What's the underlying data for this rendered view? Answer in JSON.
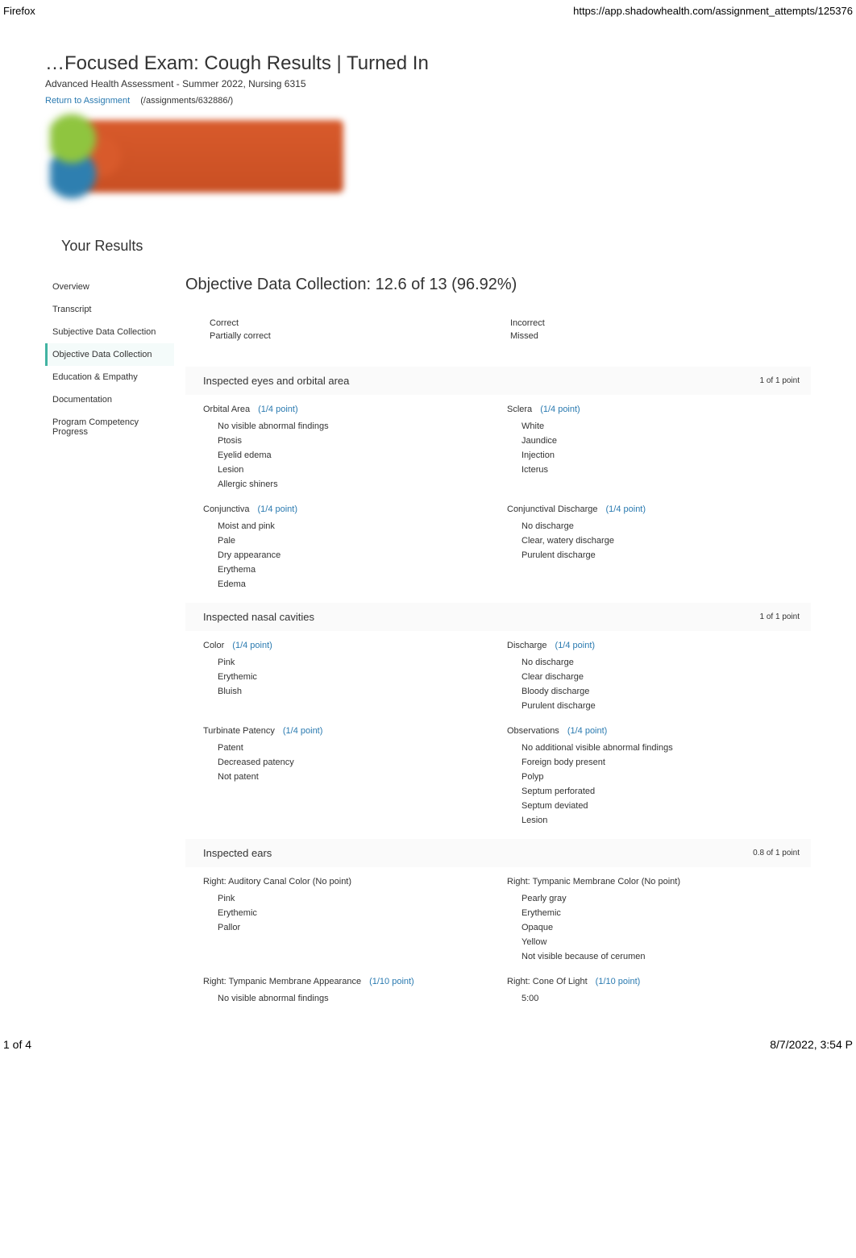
{
  "browser": {
    "name": "Firefox",
    "url": "https://app.shadowhealth.com/assignment_attempts/125376"
  },
  "header": {
    "title": "…Focused Exam: Cough Results | Turned In",
    "subtitle": "Advanced Health Assessment - Summer 2022, Nursing 6315",
    "return_link_label": "Return to Assignment",
    "return_path": "(/assignments/632886/)"
  },
  "results_heading": "Your Results",
  "sidebar": {
    "items": [
      {
        "label": "Overview",
        "active": false
      },
      {
        "label": "Transcript",
        "active": false
      },
      {
        "label": "Subjective Data Collection",
        "active": false
      },
      {
        "label": "Objective Data Collection",
        "active": true
      },
      {
        "label": "Education & Empathy",
        "active": false
      },
      {
        "label": "Documentation",
        "active": false
      },
      {
        "label": "Program Competency Progress",
        "active": false
      }
    ]
  },
  "main": {
    "section_title": "Objective Data Collection: 12.6 of 13 (96.92%)",
    "legend": {
      "left": [
        "Correct",
        "Partially correct"
      ],
      "right": [
        "Incorrect",
        "Missed"
      ]
    },
    "categories": [
      {
        "title": "Inspected eyes and orbital area",
        "score": "1 of 1 point",
        "groups": [
          {
            "left": {
              "header": "Orbital Area",
              "fraction": "(1/4 point)",
              "items": [
                "No visible abnormal findings",
                "Ptosis",
                "Eyelid edema",
                "Lesion",
                "Allergic shiners"
              ]
            },
            "right": {
              "header": "Sclera",
              "fraction": "(1/4 point)",
              "items": [
                "White",
                "Jaundice",
                "Injection",
                "Icterus"
              ]
            }
          },
          {
            "left": {
              "header": "Conjunctiva",
              "fraction": "(1/4 point)",
              "items": [
                "Moist and pink",
                "Pale",
                "Dry appearance",
                "Erythema",
                "Edema"
              ]
            },
            "right": {
              "header": "Conjunctival Discharge",
              "fraction": "(1/4 point)",
              "items": [
                "No discharge",
                "Clear, watery discharge",
                "Purulent discharge"
              ]
            }
          }
        ]
      },
      {
        "title": "Inspected nasal cavities",
        "score": "1 of 1 point",
        "groups": [
          {
            "left": {
              "header": "Color",
              "fraction": "(1/4 point)",
              "items": [
                "Pink",
                "Erythemic",
                "Bluish"
              ]
            },
            "right": {
              "header": "Discharge",
              "fraction": "(1/4 point)",
              "items": [
                "No discharge",
                "Clear discharge",
                "Bloody discharge",
                "Purulent discharge"
              ]
            }
          },
          {
            "left": {
              "header": "Turbinate Patency",
              "fraction": "(1/4 point)",
              "items": [
                "Patent",
                "Decreased patency",
                "Not patent"
              ]
            },
            "right": {
              "header": "Observations",
              "fraction": "(1/4 point)",
              "items": [
                "No additional visible abnormal findings",
                "Foreign body present",
                "Polyp",
                "Septum perforated",
                "Septum deviated",
                "Lesion"
              ]
            }
          }
        ]
      },
      {
        "title": "Inspected ears",
        "score": "0.8 of 1 point",
        "groups": [
          {
            "left": {
              "header": "Right: Auditory Canal Color (No point)",
              "fraction": "",
              "items": [
                "Pink",
                "Erythemic",
                "Pallor"
              ]
            },
            "right": {
              "header": "Right: Tympanic Membrane Color (No point)",
              "fraction": "",
              "items": [
                "Pearly gray",
                "Erythemic",
                "Opaque",
                "Yellow",
                "Not visible because of cerumen"
              ]
            }
          },
          {
            "left": {
              "header": "Right: Tympanic Membrane Appearance",
              "fraction": "(1/10 point)",
              "items": [
                "No visible abnormal findings"
              ]
            },
            "right": {
              "header": "Right: Cone Of Light",
              "fraction": "(1/10 point)",
              "items": [
                "5:00"
              ]
            }
          }
        ]
      }
    ]
  },
  "footer": {
    "page_count": "1 of 4",
    "timestamp": "8/7/2022, 3:54 P"
  }
}
